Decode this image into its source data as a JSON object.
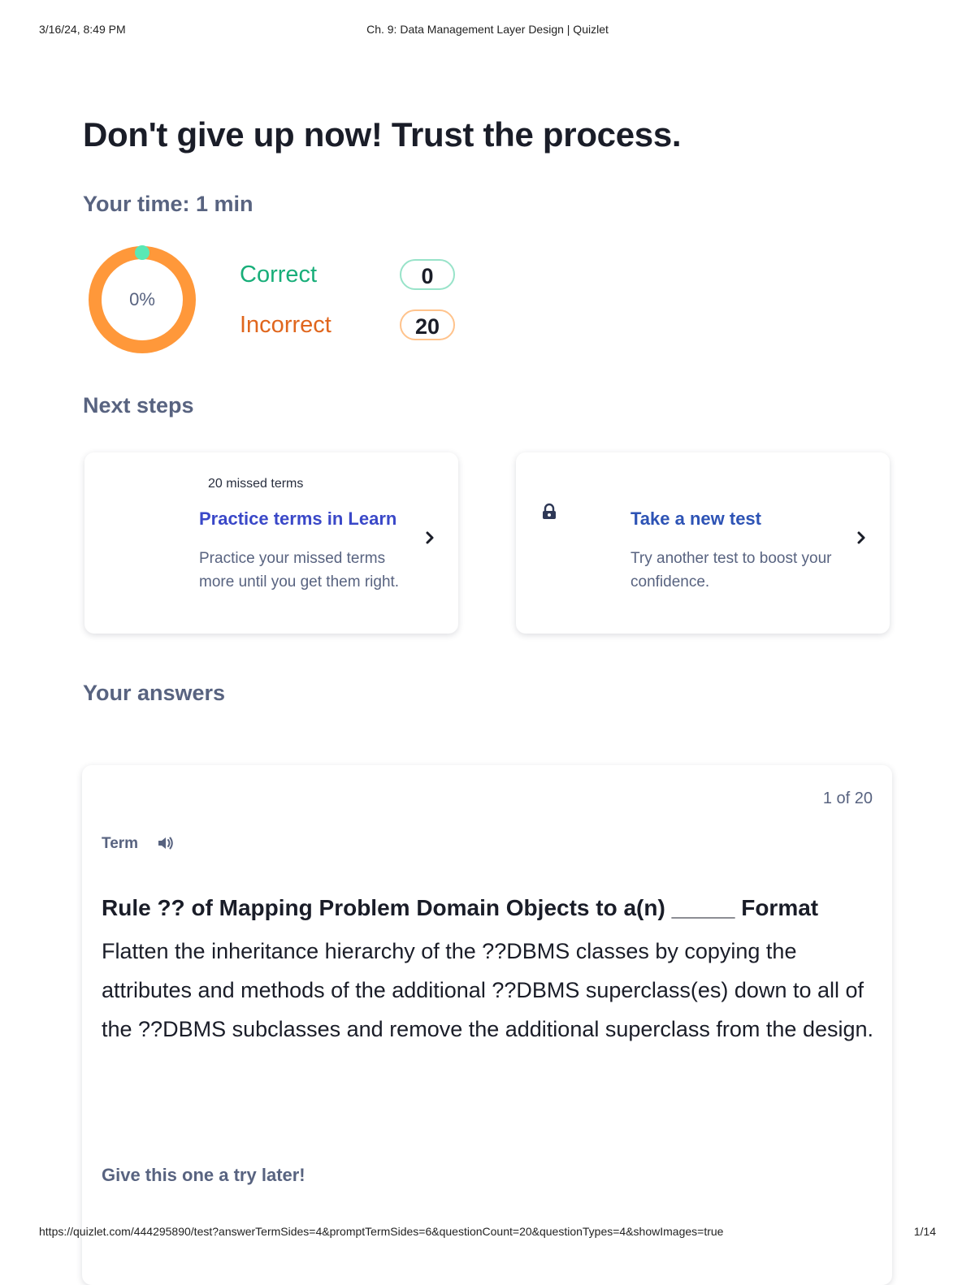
{
  "print_header": {
    "date": "3/16/24, 8:49 PM",
    "title": "Ch. 9: Data Management Layer Design | Quizlet"
  },
  "print_footer": {
    "url": "https://quizlet.com/444295890/test?answerTermSides=4&promptTermSides=6&questionCount=20&questionTypes=4&showImages=true",
    "page": "1/14"
  },
  "results": {
    "headline": "Don't give up now! Trust the process.",
    "time": "Your time: 1 min",
    "percent_label": "0%",
    "percent_value": 0,
    "correct_label": "Correct",
    "correct_count": "0",
    "incorrect_label": "Incorrect",
    "incorrect_count": "20",
    "colors": {
      "correct": "#18ae79",
      "incorrect": "#e0661d",
      "ring": "#ff983a",
      "ring_marker": "#59e8b5"
    }
  },
  "next_steps": {
    "title": "Next steps",
    "cards": [
      {
        "badge": "20 missed terms",
        "title": "Practice terms in Learn",
        "description": "Practice your missed terms more until you get them right.",
        "icon": "chevron-right-icon"
      },
      {
        "badge": "",
        "title": "Take a new test",
        "description": "Try another test to boost your confidence.",
        "icon": "lock-icon"
      }
    ]
  },
  "answers": {
    "title": "Your answers",
    "counter": "1 of 20",
    "term_label": "Term",
    "term_title": "Rule ?? of Mapping Problem Domain Objects to a(n) _____ Format",
    "term_body": "Flatten the inheritance hierarchy of the ??DBMS classes by copying the attributes and methods of the additional ??DBMS superclass(es) down to all of the ??DBMS subclasses and remove the additional superclass from the design.",
    "retry_text": "Give this one a try later!"
  }
}
